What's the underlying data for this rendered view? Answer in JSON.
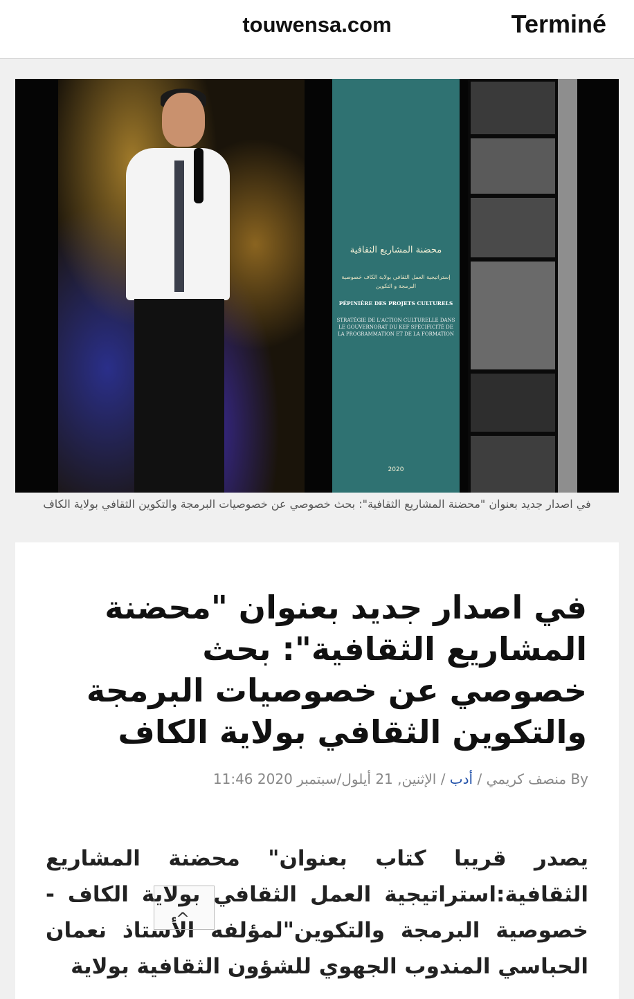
{
  "browser": {
    "url": "touwensa.com",
    "done_label": "Terminé"
  },
  "figure": {
    "cover": {
      "title_ar": "محضنة المشاريع الثقافية",
      "subtitle_ar": "إستراتيجية العمل الثقافي بولاية الكاف خصوصية البرمجة و التكوين",
      "title_fr": "PÉPINIÈRE DES PROJETS CULTURELS",
      "subtitle_fr": "STRATÉGIE DE L'ACTION CULTURELLE DANS LE GOUVERNORAT DU KEF SPÉCIFICITÉ DE LA PROGRAMMATION ET DE LA FORMATION",
      "year": "2020"
    },
    "caption": "في اصدار جديد بعنوان \"محضنة المشاريع الثقافية\": بحث خصوصي عن خصوصيات البرمجة والتكوين الثقافي بولاية الكاف"
  },
  "article": {
    "headline": "في اصدار جديد بعنوان \"محضنة المشاريع الثقافية\": بحث خصوصي عن خصوصيات البرمجة والتكوين الثقافي بولاية الكاف",
    "byline": {
      "by": "By",
      "author": "منصف كريمي",
      "category": "أدب",
      "date": "الإثنين, 21 أيلول/سبتمبر 2020 11:46"
    },
    "body": "يصدر قريبا كتاب بعنوان\" محضنة المشاريع الثقافية:استراتيجية العمل الثقافي بولاية الكاف - خصوصية البرمجة والتكوين\"لمؤلفه الأستاذ نعمان الحباسي المندوب الجهوي للشؤون الثقافية بولاية"
  }
}
